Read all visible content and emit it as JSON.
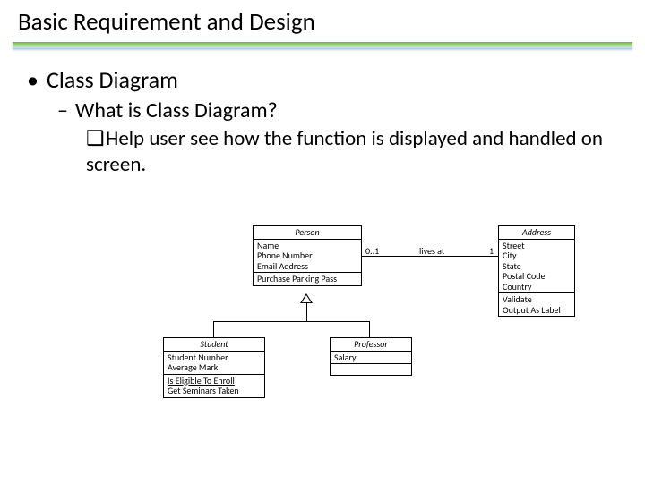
{
  "title": "Basic Requirement and Design",
  "bullets": {
    "b1": "Class Diagram",
    "b2": "What is Class Diagram?",
    "b3": "Help user see how the function is displayed and handled on screen."
  },
  "uml": {
    "person": {
      "name": "Person",
      "attrs": [
        "Name",
        "Phone Number",
        "Email Address"
      ],
      "ops": [
        "Purchase Parking Pass"
      ]
    },
    "address": {
      "name": "Address",
      "attrs": [
        "Street",
        "City",
        "State",
        "Postal Code",
        "Country"
      ],
      "ops": [
        "Validate",
        "Output As Label"
      ]
    },
    "student": {
      "name": "Student",
      "attrs": [
        "Student Number",
        "Average Mark"
      ],
      "ops": [
        "Is Eligible To Enroll",
        "Get Seminars Taken"
      ]
    },
    "professor": {
      "name": "Professor",
      "attrs": [
        "Salary"
      ]
    },
    "assoc": {
      "leftMult": "0..1",
      "label": "lives at",
      "rightMult": "1"
    }
  }
}
